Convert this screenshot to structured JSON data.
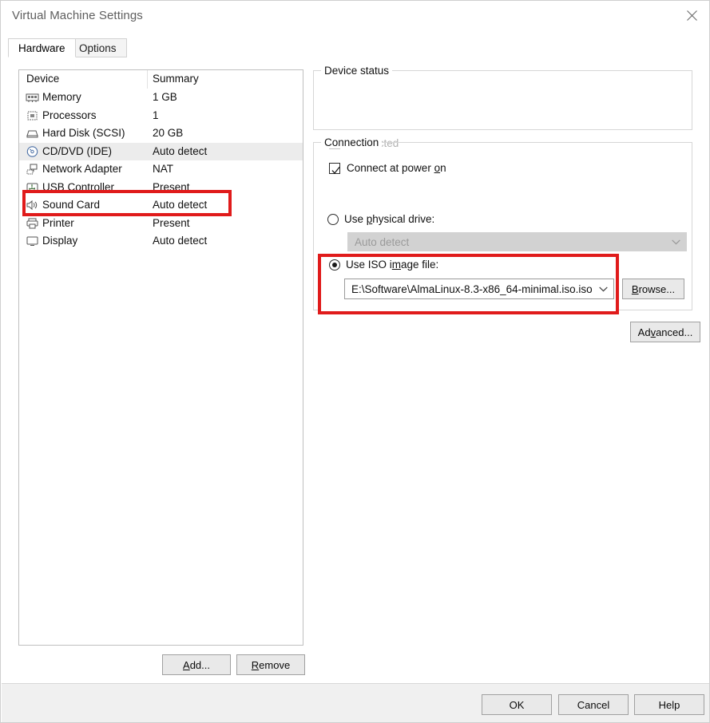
{
  "window": {
    "title": "Virtual Machine Settings",
    "close_icon": "close-icon"
  },
  "tabs": [
    {
      "label": "Hardware",
      "active": true
    },
    {
      "label": "Options",
      "active": false
    }
  ],
  "device_list": {
    "columns": [
      "Device",
      "Summary"
    ],
    "rows": [
      {
        "icon": "memory-icon",
        "name": "Memory",
        "summary": "1 GB",
        "selected": false
      },
      {
        "icon": "processor-icon",
        "name": "Processors",
        "summary": "1",
        "selected": false
      },
      {
        "icon": "harddisk-icon",
        "name": "Hard Disk (SCSI)",
        "summary": "20 GB",
        "selected": false
      },
      {
        "icon": "cddvd-icon",
        "name": "CD/DVD (IDE)",
        "summary": "Auto detect",
        "selected": true
      },
      {
        "icon": "network-icon",
        "name": "Network Adapter",
        "summary": "NAT",
        "selected": false
      },
      {
        "icon": "usb-icon",
        "name": "USB Controller",
        "summary": "Present",
        "selected": false
      },
      {
        "icon": "sound-icon",
        "name": "Sound Card",
        "summary": "Auto detect",
        "selected": false
      },
      {
        "icon": "printer-icon",
        "name": "Printer",
        "summary": "Present",
        "selected": false
      },
      {
        "icon": "display-icon",
        "name": "Display",
        "summary": "Auto detect",
        "selected": false
      }
    ],
    "add_label": "Add...",
    "add_mnemonic": "A",
    "remove_label": "Remove",
    "remove_mnemonic": "R"
  },
  "device_status": {
    "legend": "Device status",
    "connected": {
      "label": "Connected",
      "mnemonic": "C",
      "checked": false,
      "disabled": true
    },
    "connect_at_power_on": {
      "label": "Connect at power on",
      "mnemonic": "o",
      "checked": true,
      "disabled": false
    }
  },
  "connection": {
    "legend": "Connection",
    "physical": {
      "label": "Use physical drive:",
      "mnemonic": "p",
      "selected": false,
      "value": "Auto detect",
      "disabled": true
    },
    "iso": {
      "label": "Use ISO image file:",
      "mnemonic": "m",
      "selected": true,
      "value": "E:\\Software\\AlmaLinux-8.3-x86_64-minimal.iso.iso",
      "disabled": false
    },
    "browse_label": "Browse...",
    "browse_mnemonic": "B",
    "advanced_label": "Advanced...",
    "advanced_mnemonic": "v"
  },
  "footer": {
    "ok_label": "OK",
    "cancel_label": "Cancel",
    "help_label": "Help"
  },
  "annotations": {
    "color": "#e01b1b",
    "boxes": [
      {
        "name": "cddvd-row-highlight"
      },
      {
        "name": "iso-option-highlight"
      }
    ]
  }
}
